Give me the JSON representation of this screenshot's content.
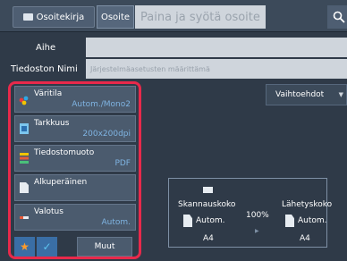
{
  "header": {
    "address_book_label": "Osoitekirja",
    "address_tab_label": "Osoite",
    "address_placeholder": "Paina ja syötä osoite"
  },
  "fields": {
    "subject_label": "Aihe",
    "filename_label": "Tiedoston Nimi",
    "filename_value": "Järjestelmäasetusten määrittämä"
  },
  "options_label": "Vaihtoehdot",
  "settings": [
    {
      "label": "Väritila",
      "value": "Autom./Mono2",
      "icon": "color-mode-icon"
    },
    {
      "label": "Tarkkuus",
      "value": "200x200dpi",
      "icon": "resolution-icon"
    },
    {
      "label": "Tiedostomuoto",
      "value": "PDF",
      "icon": "file-format-icon"
    },
    {
      "label": "Alkuperäinen",
      "value": "",
      "icon": "original-icon"
    },
    {
      "label": "Valotus",
      "value": "Autom.",
      "icon": "exposure-icon"
    }
  ],
  "bottom": {
    "more_label": "Muut"
  },
  "scan_panel": {
    "scan_size_label": "Skannauskoko",
    "scan_size_value": "Autom.",
    "scan_size_paper": "A4",
    "ratio": "100%",
    "send_size_label": "Lähetyskoko",
    "send_size_value": "Autom.",
    "send_size_paper": "A4"
  },
  "colors": {
    "accent_red": "#e8294b",
    "value_blue": "#7fb4e2",
    "star_orange": "#ff9c2b"
  }
}
